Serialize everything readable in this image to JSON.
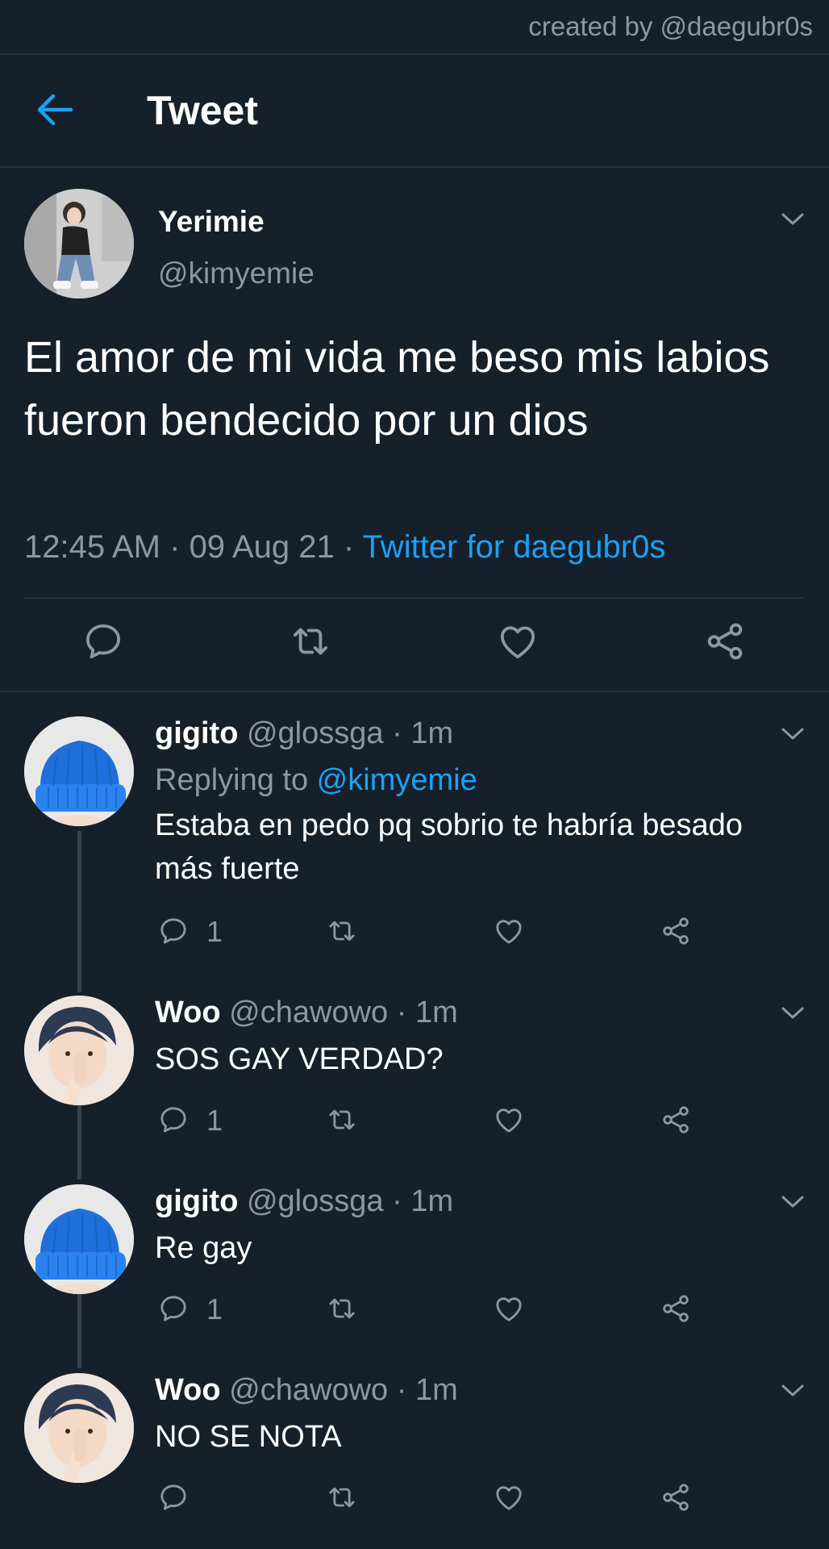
{
  "watermark": "created by @daegubr0s",
  "header": {
    "title": "Tweet",
    "back_icon": "arrow-left-icon"
  },
  "colors": {
    "background": "#15202b",
    "accent": "#1da1f2",
    "muted": "#8899a6",
    "divider": "#253341"
  },
  "main_tweet": {
    "name": "Yerimie",
    "handle": "@kimyemie",
    "text": "El amor de mi vida me beso mis labios fueron bendecido por un dios",
    "time": "12:45 AM",
    "date": "09 Aug 21",
    "client": "Twitter for daegubr0s",
    "separator": " · "
  },
  "replies": [
    {
      "name": "gigito",
      "handle": "@glossga",
      "time": "1m",
      "replying_prefix": "Replying to ",
      "replying_to": "@kimyemie",
      "text": "Estaba en pedo pq sobrio te habría besado más fuerte",
      "reply_count": "1"
    },
    {
      "name": "Woo",
      "handle": "@chawowo",
      "time": "1m",
      "text": "SOS GAY VERDAD?",
      "reply_count": "1"
    },
    {
      "name": "gigito",
      "handle": "@glossga",
      "time": "1m",
      "text": "Re gay",
      "reply_count": "1"
    },
    {
      "name": "Woo",
      "handle": "@chawowo",
      "time": "1m",
      "text": "NO SE NOTA",
      "reply_count": ""
    }
  ],
  "dot": " · "
}
